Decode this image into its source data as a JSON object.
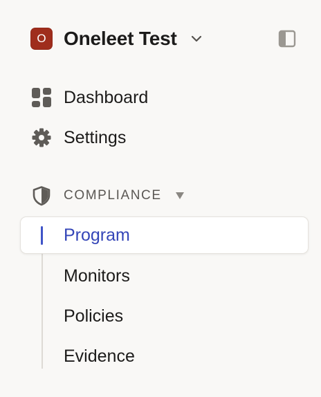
{
  "org": {
    "initial": "O",
    "name": "Oneleet Test",
    "avatar_color": "#9f2d1c"
  },
  "nav": {
    "items": [
      {
        "label": "Dashboard",
        "icon": "dashboard-grid-icon"
      },
      {
        "label": "Settings",
        "icon": "gear-icon"
      }
    ]
  },
  "compliance": {
    "title": "COMPLIANCE",
    "icon": "shield-icon",
    "items": [
      {
        "label": "Program",
        "active": true
      },
      {
        "label": "Monitors",
        "active": false
      },
      {
        "label": "Policies",
        "active": false
      },
      {
        "label": "Evidence",
        "active": false
      }
    ]
  },
  "colors": {
    "background": "#f9f8f6",
    "accent": "#3f54c8",
    "text": "#1c1b1a",
    "muted": "#5b5854"
  }
}
